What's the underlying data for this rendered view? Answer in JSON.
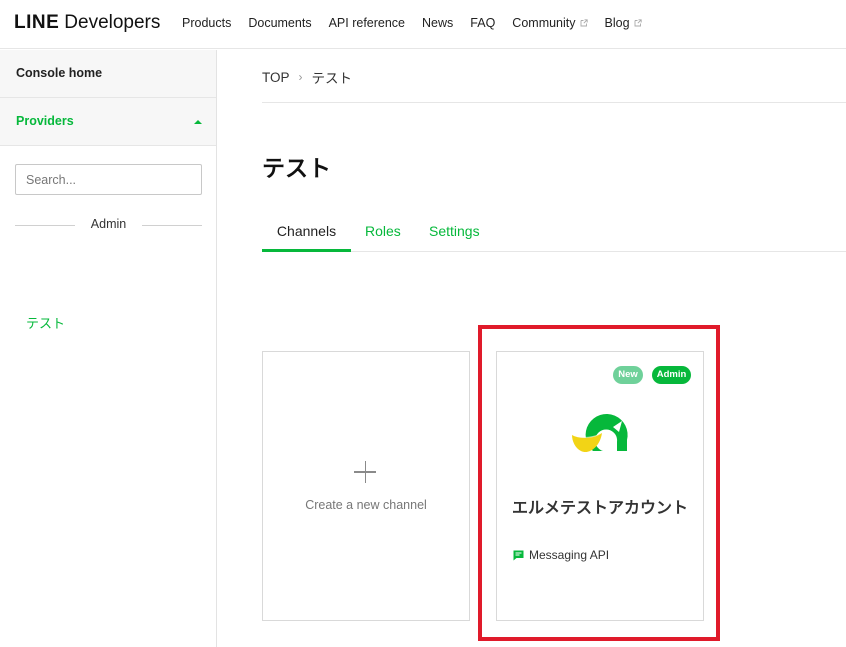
{
  "header": {
    "logo_line": "LINE",
    "logo_dev": "Developers",
    "nav": [
      {
        "label": "Products",
        "external": false
      },
      {
        "label": "Documents",
        "external": false
      },
      {
        "label": "API reference",
        "external": false
      },
      {
        "label": "News",
        "external": false
      },
      {
        "label": "FAQ",
        "external": false
      },
      {
        "label": "Community",
        "external": true
      },
      {
        "label": "Blog",
        "external": true
      }
    ]
  },
  "sidebar": {
    "console_home": "Console home",
    "providers": "Providers",
    "search_placeholder": "Search...",
    "role_divider": "Admin",
    "provider_item": "テスト"
  },
  "breadcrumb": {
    "top": "TOP",
    "current": "テスト"
  },
  "page": {
    "title": "テスト",
    "tabs": [
      "Channels",
      "Roles",
      "Settings"
    ],
    "active_tab": "Channels"
  },
  "cards": {
    "create_label": "Create a new channel",
    "channel": {
      "badge_new": "New",
      "badge_admin": "Admin",
      "name": "エルメテストアカウント",
      "type": "Messaging API"
    }
  },
  "colors": {
    "accent": "#06b83b",
    "highlight": "#e01a2a"
  }
}
